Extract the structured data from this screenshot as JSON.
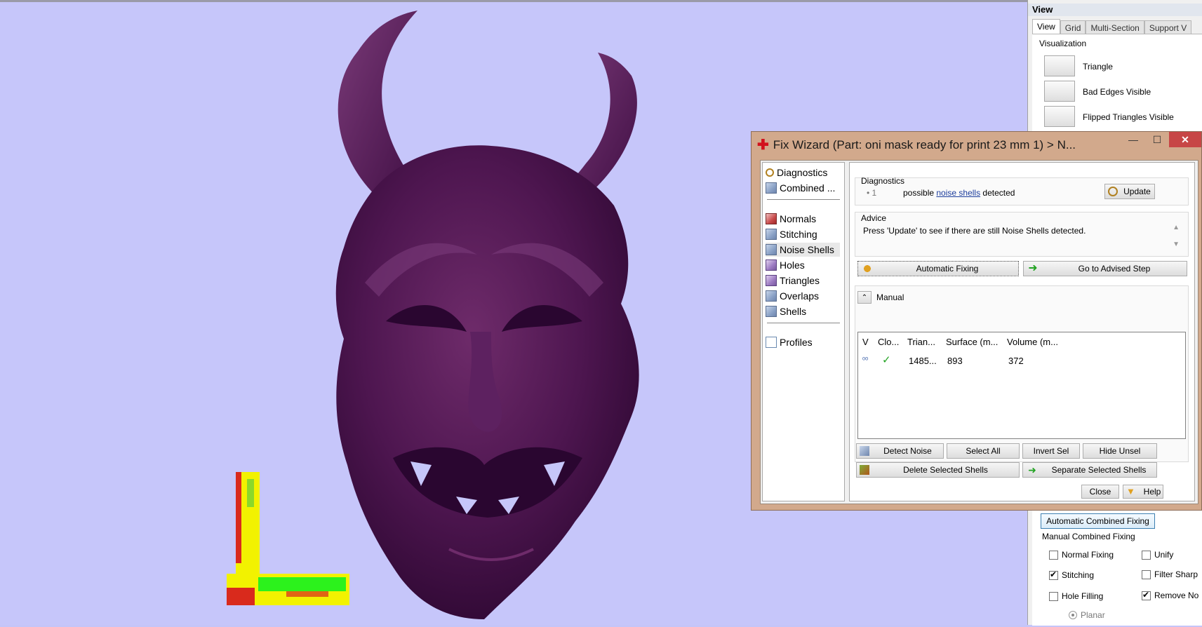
{
  "right_panel": {
    "title": "View",
    "tabs": [
      "View",
      "Grid",
      "Multi-Section",
      "Support V"
    ],
    "visualization_label": "Visualization",
    "vis_items": [
      "Triangle",
      "Bad Edges Visible",
      "Flipped Triangles Visible"
    ],
    "auto_combined_fixing": "Automatic Combined Fixing",
    "manual_combined_label": "Manual Combined Fixing",
    "checks": [
      {
        "label": "Normal Fixing",
        "checked": false
      },
      {
        "label": "Unify",
        "checked": false
      },
      {
        "label": "Stitching",
        "checked": true
      },
      {
        "label": "Filter Sharp",
        "checked": false
      },
      {
        "label": "Hole Filling",
        "checked": false
      },
      {
        "label": "Remove No",
        "checked": true
      }
    ],
    "radio_planar": "Planar"
  },
  "dialog": {
    "title": "Fix Wizard (Part: oni mask ready for print 23 mm 1) > N...",
    "nav_top": [
      {
        "label": "Diagnostics",
        "icon": "magnifier-icon"
      },
      {
        "label": "Combined ...",
        "icon": "combined-cube-icon"
      }
    ],
    "nav_mid": [
      {
        "label": "Normals",
        "icon": "normals-icon"
      },
      {
        "label": "Stitching",
        "icon": "stitching-icon"
      },
      {
        "label": "Noise Shells",
        "icon": "noise-shells-icon"
      },
      {
        "label": "Holes",
        "icon": "holes-icon"
      },
      {
        "label": "Triangles",
        "icon": "triangles-icon"
      },
      {
        "label": "Overlaps",
        "icon": "overlaps-icon"
      },
      {
        "label": "Shells",
        "icon": "shells-icon"
      }
    ],
    "nav_bottom": [
      {
        "label": "Profiles",
        "icon": "profiles-icon"
      }
    ],
    "diagnostics_label": "Diagnostics",
    "diag_bullet_num": "1",
    "diag_text_pre": "possible",
    "diag_link": "noise shells",
    "diag_text_post": "detected",
    "update_btn": "Update",
    "advice_label": "Advice",
    "advice_text": "Press 'Update' to see if there are still Noise Shells detected.",
    "auto_fix_btn": "Automatic Fixing",
    "advised_btn": "Go to Advised Step",
    "manual_label": "Manual",
    "table_headers": [
      "V",
      "Clo...",
      "Trian...",
      "Surface (m...",
      "Volume (m..."
    ],
    "table_row": {
      "triangles": "1485...",
      "surface": "893",
      "volume": "372"
    },
    "detect_noise_btn": "Detect Noise",
    "select_all_btn": "Select All",
    "invert_sel_btn": "Invert Sel",
    "hide_unsel_btn": "Hide Unsel",
    "delete_btn": "Delete Selected Shells",
    "separate_btn": "Separate Selected Shells",
    "close_btn": "Close",
    "help_btn": "Help"
  }
}
